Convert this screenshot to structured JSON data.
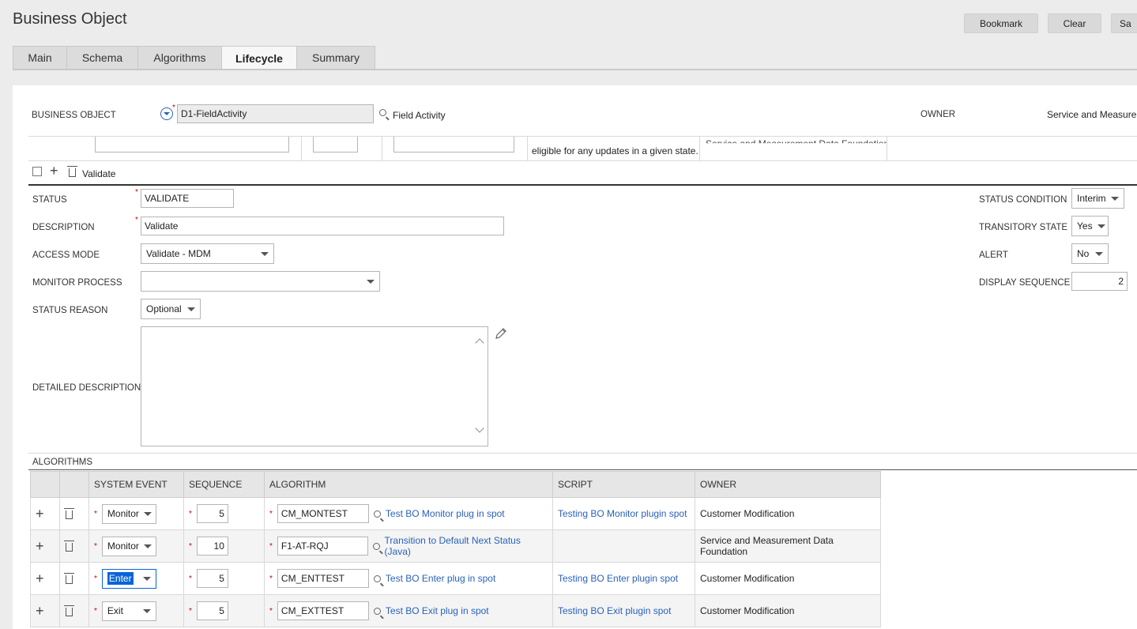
{
  "page": {
    "title": "Business Object"
  },
  "toolbar": {
    "bookmark": "Bookmark",
    "clear": "Clear",
    "save": "Sa"
  },
  "tabs": [
    "Main",
    "Schema",
    "Algorithms",
    "Lifecycle",
    "Summary"
  ],
  "header": {
    "bo_label": "BUSINESS OBJECT",
    "bo_value": "D1-FieldActivity",
    "bo_desc": "Field Activity",
    "owner_label": "OWNER",
    "owner_value": "Service and Measureme"
  },
  "prev_row": {
    "desc_fragment": "eligible for any updates in a given state.",
    "owner_fragment": "Service and Measurement Data Foundation"
  },
  "state": {
    "name": "Validate",
    "status_label": "STATUS",
    "status_value": "VALIDATE",
    "description_label": "DESCRIPTION",
    "description_value": "Validate",
    "access_mode_label": "ACCESS MODE",
    "access_mode_value": "Validate - MDM",
    "monitor_label": "MONITOR PROCESS",
    "monitor_value": "",
    "status_reason_label": "STATUS REASON",
    "status_reason_value": "Optional",
    "detailed_label": "DETAILED DESCRIPTION",
    "status_condition_label": "STATUS CONDITION",
    "status_condition_value": "Interim",
    "transitory_label": "TRANSITORY STATE",
    "transitory_value": "Yes",
    "alert_label": "ALERT",
    "alert_value": "No",
    "display_seq_label": "DISPLAY SEQUENCE",
    "display_seq_value": "2"
  },
  "algorithms": {
    "section_label": "ALGORITHMS",
    "columns": [
      "SYSTEM EVENT",
      "SEQUENCE",
      "ALGORITHM",
      "SCRIPT",
      "OWNER"
    ],
    "rows": [
      {
        "event": "Monitor",
        "seq": "5",
        "algo": "CM_MONTEST",
        "algo_desc": "Test BO Monitor plug in spot",
        "script": "Testing BO Monitor plugin spot",
        "owner": "Customer Modification"
      },
      {
        "event": "Monitor",
        "seq": "10",
        "algo": "F1-AT-RQJ",
        "algo_desc": "Transition to Default Next Status (Java)",
        "script": "",
        "owner": "Service and Measurement Data Foundation"
      },
      {
        "event": "Enter",
        "seq": "5",
        "algo": "CM_ENTTEST",
        "algo_desc": "Test BO Enter plug in spot",
        "script": "Testing BO Enter plugin spot",
        "owner": "Customer Modification"
      },
      {
        "event": "Exit",
        "seq": "5",
        "algo": "CM_EXTTEST",
        "algo_desc": "Test BO Exit plug in spot",
        "script": "Testing BO Exit plugin spot",
        "owner": "Customer Modification"
      }
    ]
  }
}
